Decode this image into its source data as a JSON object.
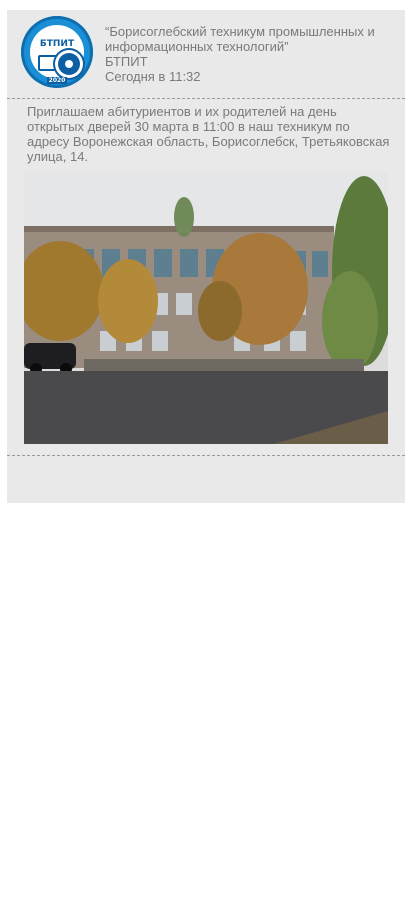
{
  "post": {
    "org_name": "“Борисоглебский техникум промышленных и информационных технологий”",
    "org_abbr": "БТПИТ",
    "timestamp": "Сегодня в 11:32",
    "text": "Приглашаем абитуриентов и их родителей на день открытых дверей 30 марта в 11:00 в наш техникум по адресу Воронежская область, Борисоглебск, Третьяковская улица, 14."
  },
  "logo": {
    "abbr": "БТПИТ",
    "year": "2020"
  },
  "colors": {
    "card_bg": "#e9e9e9",
    "text": "#7a7a7a",
    "logo_blue": "#1a8fd6"
  },
  "icons": {
    "avatar": "college-logo"
  }
}
